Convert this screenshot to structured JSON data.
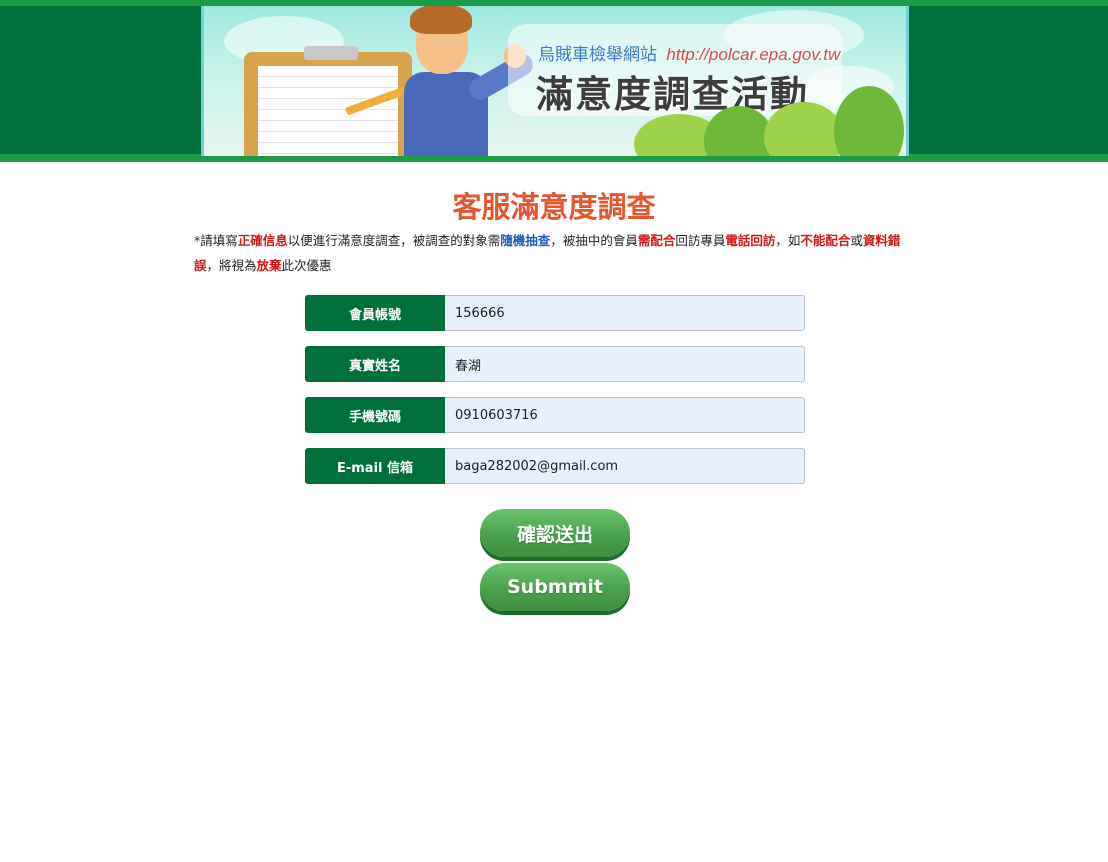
{
  "banner": {
    "site_name": "烏賊車檢舉網站",
    "url": "http://polcar.epa.gov.tw",
    "headline": "滿意度調查活動"
  },
  "survey": {
    "title": "客服滿意度調查",
    "notice": [
      {
        "text": "*請填寫",
        "style": "plain"
      },
      {
        "text": "正確信息",
        "style": "red"
      },
      {
        "text": "以便進行滿意度調查，被調查的對象需",
        "style": "plain"
      },
      {
        "text": "隨機抽查",
        "style": "blue"
      },
      {
        "text": "，被抽中的會員",
        "style": "plain"
      },
      {
        "text": "需配合",
        "style": "red"
      },
      {
        "text": "回訪專員",
        "style": "plain"
      },
      {
        "text": "電話回訪",
        "style": "red"
      },
      {
        "text": "，如",
        "style": "plain"
      },
      {
        "text": "不能配合",
        "style": "red"
      },
      {
        "text": "或",
        "style": "plain"
      },
      {
        "text": "資料錯誤",
        "style": "red"
      },
      {
        "text": "，將視為",
        "style": "plain"
      },
      {
        "text": "放棄",
        "style": "red"
      },
      {
        "text": "此次優惠",
        "style": "plain"
      }
    ]
  },
  "form": {
    "account": {
      "label": "會員帳號",
      "value": "156666"
    },
    "name": {
      "label": "真實姓名",
      "value": "春湖"
    },
    "phone": {
      "label": "手機號碼",
      "value": "0910603716"
    },
    "email": {
      "label": "E-mail 信箱",
      "value": "baga282002@gmail.com"
    }
  },
  "buttons": {
    "confirm": "確認送出",
    "submit": "Submmit"
  },
  "colors": {
    "header_green": "#00703a",
    "title_orange": "#e4572e",
    "highlight_red": "#d01818",
    "highlight_blue": "#1f5fb3",
    "button_green": "#4aa04c",
    "input_bg": "#e8f0fe"
  }
}
